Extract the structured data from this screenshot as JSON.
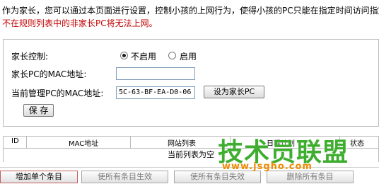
{
  "intro": {
    "line1": "作为家长，您可以通过本页面进行设置，控制小孩的上网行为，使得小孩的PC只能在指定时间访问指定",
    "line2": "不在规则列表中的非家长PC将无法上网。"
  },
  "form": {
    "parental_control_label": "家长控制:",
    "disable_label": "不启用",
    "enable_label": "启用",
    "selected": "不启用",
    "parent_mac_label": "家长PC的MAC地址:",
    "parent_mac_value": "",
    "current_mac_label": "当前管理PC的MAC地址:",
    "current_mac_value": "5C-63-BF-EA-D0-06",
    "set_parent_button": "设为家长PC",
    "save_button": "保 存"
  },
  "table": {
    "columns": [
      "ID",
      "MAC地址",
      "网站列表",
      "日程计划",
      "状态"
    ],
    "empty_text": "当前列表为空"
  },
  "actions": {
    "add_entry": "增加单个条目",
    "enable_all": "使所有条目生效",
    "disable_all": "使所有条目失效",
    "delete_all": "删除所有条目"
  },
  "watermark": {
    "main": "技术员联盟",
    "sub": "www.jsgho.com"
  }
}
